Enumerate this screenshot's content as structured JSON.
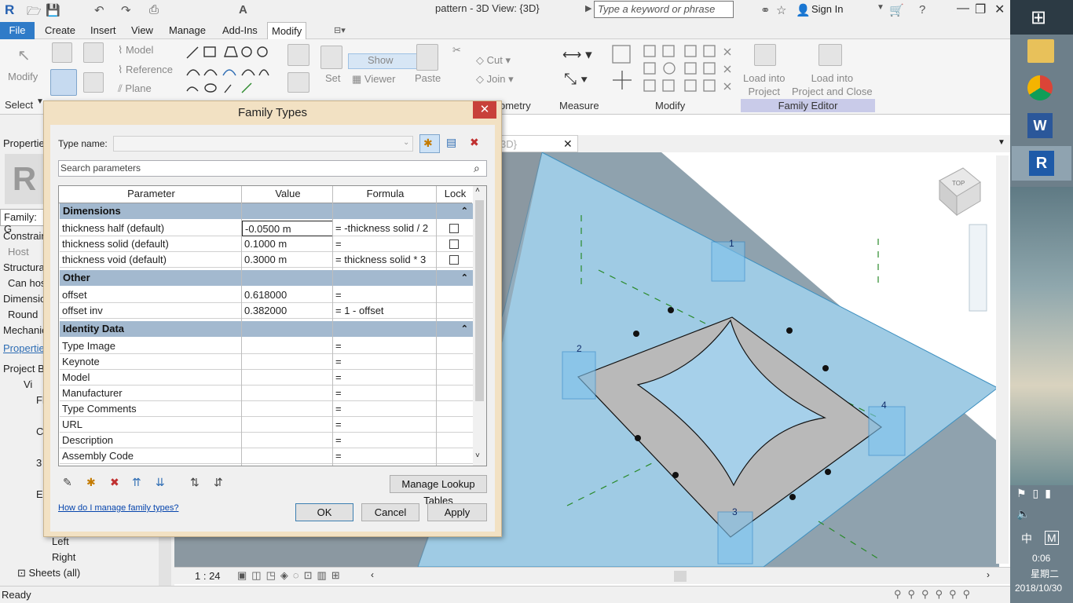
{
  "window": {
    "title": "pattern - 3D View: {3D}",
    "search_placeholder": "Type a keyword or phrase",
    "sign_in": "Sign In"
  },
  "menu": [
    "File",
    "Create",
    "Insert",
    "View",
    "Manage",
    "Add-Ins",
    "Modify"
  ],
  "ribbon": {
    "modify": "Modify",
    "select": "Select",
    "model": "Model",
    "reference": "Reference",
    "plane": "Plane",
    "set": "Set",
    "show": "Show",
    "viewer": "Viewer",
    "paste": "Paste",
    "cut": "Cut",
    "join": "Join",
    "geometry": "ometry",
    "measure": "Measure",
    "modify_group": "Modify",
    "load_into_project": "Load into\nProject",
    "load_into_project_close": "Load into\nProject and Close",
    "family_editor": "Family Editor"
  },
  "left_panel": {
    "properties": "Propertie",
    "family": "Family: G",
    "rows": [
      "Constrain",
      "Host",
      "Structura",
      "Can hos",
      "Dimensio",
      "Round",
      "Mechanic"
    ],
    "properties_link": "Propertie",
    "project_browser": "Project B",
    "tree": [
      "Vi",
      "Fl",
      "C",
      "3",
      "E",
      "Left",
      "Right",
      "Sheets (all)"
    ]
  },
  "view_tab": {
    "label": "3D}"
  },
  "view_bar": {
    "scale": "1 : 24"
  },
  "status": {
    "text": "Ready"
  },
  "taskbar": {
    "time": "0:06",
    "day": "星期二",
    "date": "2018/10/30",
    "ime1": "中",
    "ime2": "M"
  },
  "viewport": {
    "labels": [
      "1",
      "2",
      "3",
      "4"
    ],
    "view_cube": "TOP"
  },
  "dialog": {
    "title": "Family Types",
    "type_name_label": "Type name:",
    "search_placeholder": "Search parameters",
    "headers": {
      "parameter": "Parameter",
      "value": "Value",
      "formula": "Formula",
      "lock": "Lock"
    },
    "groups": [
      {
        "name": "Dimensions",
        "rows": [
          {
            "p": "thickness half (default)",
            "v": "-0.0500 m",
            "f": "= -thickness solid / 2",
            "lock": true
          },
          {
            "p": "thickness solid (default)",
            "v": "0.1000 m",
            "f": "=",
            "lock": true
          },
          {
            "p": "thickness void (default)",
            "v": "0.3000 m",
            "f": "= thickness solid * 3",
            "lock": true
          }
        ]
      },
      {
        "name": "Other",
        "rows": [
          {
            "p": "offset",
            "v": "0.618000",
            "f": "=",
            "lock": false
          },
          {
            "p": "offset inv",
            "v": "0.382000",
            "f": "= 1 - offset",
            "lock": false
          }
        ]
      },
      {
        "name": "Identity Data",
        "rows": [
          {
            "p": "Type Image",
            "v": "",
            "f": "=",
            "lock": false
          },
          {
            "p": "Keynote",
            "v": "",
            "f": "=",
            "lock": false
          },
          {
            "p": "Model",
            "v": "",
            "f": "=",
            "lock": false
          },
          {
            "p": "Manufacturer",
            "v": "",
            "f": "=",
            "lock": false
          },
          {
            "p": "Type Comments",
            "v": "",
            "f": "=",
            "lock": false
          },
          {
            "p": "URL",
            "v": "",
            "f": "=",
            "lock": false
          },
          {
            "p": "Description",
            "v": "",
            "f": "=",
            "lock": false
          },
          {
            "p": "Assembly Code",
            "v": "",
            "f": "=",
            "lock": false
          }
        ]
      }
    ],
    "manage_lookup": "Manage Lookup Tables",
    "help_link": "How do I manage family types?",
    "ok": "OK",
    "cancel": "Cancel",
    "apply": "Apply"
  }
}
